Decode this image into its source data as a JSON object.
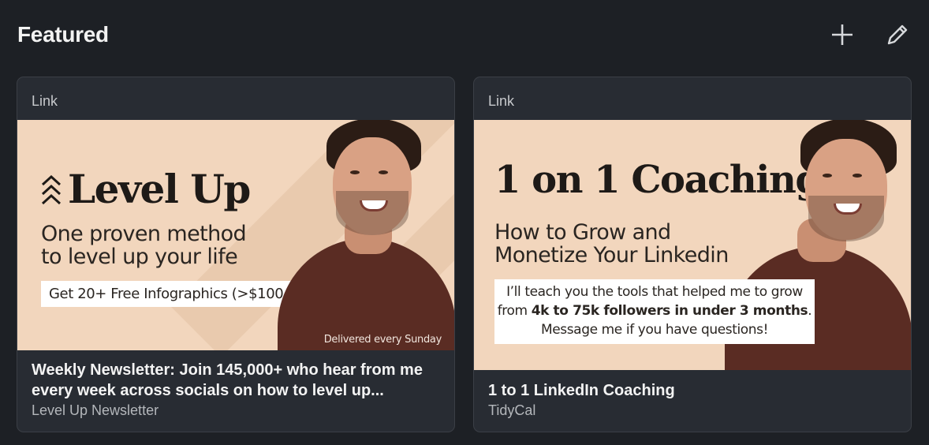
{
  "section": {
    "title": "Featured"
  },
  "actions": {
    "add_icon": "plus-icon",
    "edit_icon": "pencil-icon"
  },
  "cards": [
    {
      "kind": "Link",
      "banner": {
        "headline": "Level Up",
        "tagline_line1": "One proven method",
        "tagline_line2": "to level up your life",
        "box_text": "Get 20+ Free Infographics  (>$100 Value)",
        "footnote": "Delivered every Sunday"
      },
      "title": "Weekly Newsletter: Join 145,000+ who hear from me every week across socials on how to level up...",
      "subtitle": "Level Up Newsletter"
    },
    {
      "kind": "Link",
      "banner": {
        "headline": "1 on 1 Coaching",
        "tagline_line1": "How to Grow and",
        "tagline_line2": "Monetize Your Linkedin",
        "box_line1": "I’ll teach you the tools that helped me to grow",
        "box_line2_pre": "from ",
        "box_line2_bold": "4k to 75k followers in under 3 months",
        "box_line2_post": ".",
        "box_line3": "Message me if you have questions!"
      },
      "title": "1 to 1 LinkedIn Coaching",
      "subtitle": "TidyCal"
    }
  ],
  "colors": {
    "page_bg": "#1d2025",
    "card_bg": "#282c33",
    "banner_bg": "#f2d6bd",
    "shirt": "#5a2c23"
  }
}
